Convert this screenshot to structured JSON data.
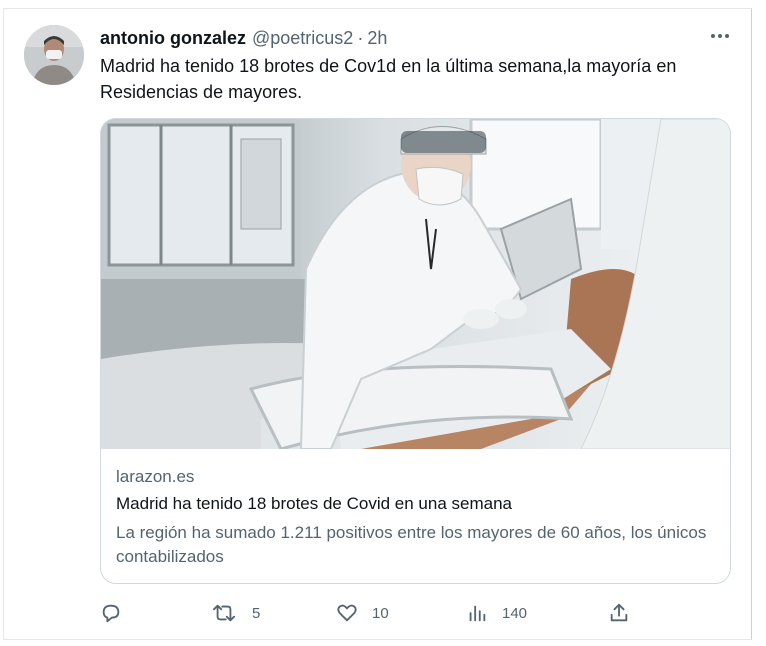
{
  "tweet": {
    "author_name": "antonio gonzalez",
    "author_handle": "@poetricus2",
    "separator": "·",
    "time": "2h",
    "text": "Madrid ha tenido 18 brotes de Cov1d en la última semana,la mayoría en Residencias de mayores."
  },
  "card": {
    "domain": "larazon.es",
    "title": "Madrid ha tenido 18 brotes de Covid en una semana",
    "description": "La región ha sumado 1.211 positivos entre los mayores de 60 años, los únicos contabilizados"
  },
  "actions": {
    "replies": "",
    "retweets": "5",
    "likes": "10",
    "views": "140"
  },
  "icons": {
    "more": "more-icon",
    "reply": "reply-icon",
    "retweet": "retweet-icon",
    "like": "heart-icon",
    "views": "views-icon",
    "share": "share-icon"
  },
  "colors": {
    "text_primary": "#0f1419",
    "text_secondary": "#536471",
    "border": "#cfd9de"
  }
}
